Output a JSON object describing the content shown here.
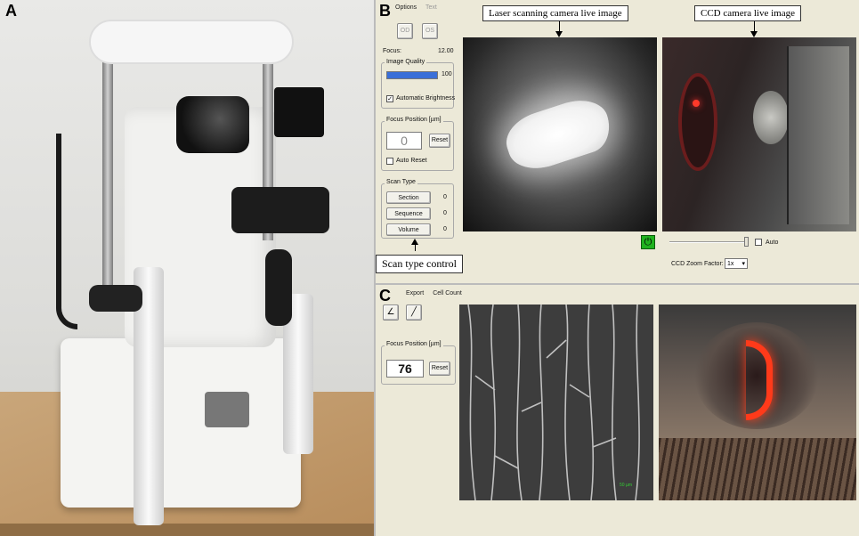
{
  "panel_letters": {
    "a": "A",
    "b": "B",
    "c": "C"
  },
  "panelB": {
    "menu": {
      "options": "Options",
      "text": "Text"
    },
    "eye_buttons": {
      "od": "OD",
      "os": "OS"
    },
    "focus": {
      "label": "Focus:",
      "value": "12.00"
    },
    "image_quality": {
      "label": "Image Quality",
      "value": "100",
      "level_percent": 100
    },
    "auto_brightness": {
      "label": "Automatic Brightness",
      "checked": true
    },
    "focus_position": {
      "label": "Focus Position [µm]",
      "value": "0",
      "reset": "Reset"
    },
    "auto_reset": {
      "label": "Auto Reset",
      "checked": false
    },
    "scan_type": {
      "label": "Scan Type",
      "items": [
        {
          "label": "Section",
          "count": "0"
        },
        {
          "label": "Sequence",
          "count": "0"
        },
        {
          "label": "Volume",
          "count": "0"
        }
      ]
    },
    "annotations": {
      "laser": "Laser scanning camera live image",
      "ccd": "CCD camera live image",
      "scan_type_control": "Scan type control"
    },
    "power_icon": "power-icon",
    "auto_checkbox": {
      "label": "Auto",
      "checked": false
    },
    "ccd_zoom": {
      "label": "CCD Zoom Factor:",
      "value": "1x"
    }
  },
  "panelC": {
    "menu": {
      "export": "Export",
      "cell_count": "Cell Count"
    },
    "focus_position": {
      "label": "Focus Position [µm]",
      "value": "76",
      "reset": "Reset"
    },
    "scale_label": "50 µm"
  },
  "colors": {
    "ui_bg": "#ece9d8",
    "quality_bar": "#3a6fd8",
    "power_green": "#1fb21f"
  }
}
